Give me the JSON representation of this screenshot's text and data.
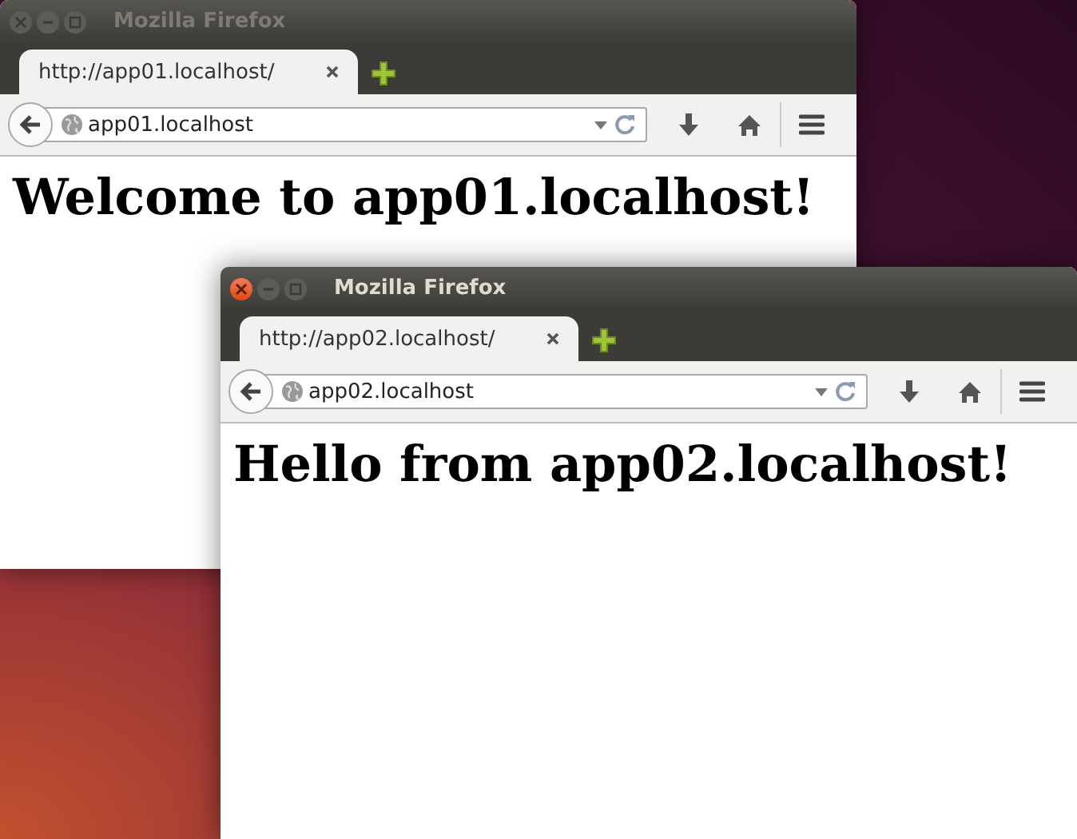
{
  "windows": [
    {
      "title": "Mozilla Firefox",
      "active": false,
      "tab": {
        "label": "http://app01.localhost/"
      },
      "url": "app01.localhost",
      "heading": "Welcome to app01.localhost!"
    },
    {
      "title": "Mozilla Firefox",
      "active": true,
      "tab": {
        "label": "http://app02.localhost/"
      },
      "url": "app02.localhost",
      "heading": "Hello from app02.localhost!"
    }
  ]
}
